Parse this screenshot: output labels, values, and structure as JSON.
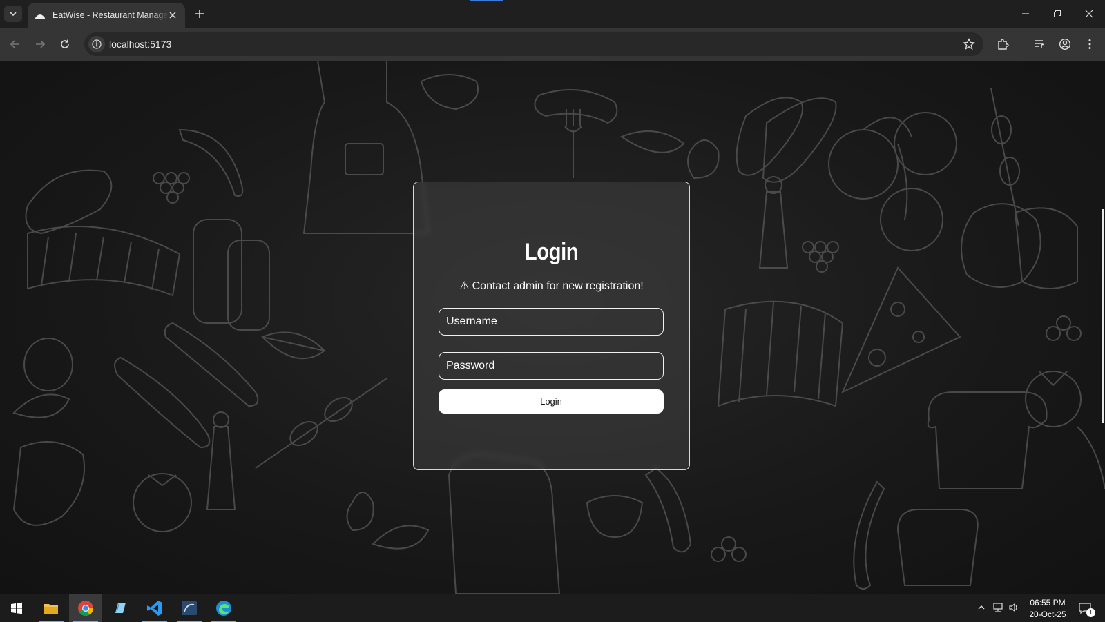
{
  "browser": {
    "tab_title": "EatWise - Restaurant Management",
    "url": "localhost:5173"
  },
  "login": {
    "heading": "Login",
    "notice_icon": "⚠",
    "notice": "Contact admin for new registration!",
    "username_placeholder": "Username",
    "password_placeholder": "Password",
    "button_label": "Login"
  },
  "taskbar": {
    "time": "06:55 PM",
    "date": "20-Oct-25",
    "notification_count": "1"
  },
  "colors": {
    "accent": "#3d7bd9",
    "background": "#181818",
    "card_border": "#d8d8d8"
  }
}
